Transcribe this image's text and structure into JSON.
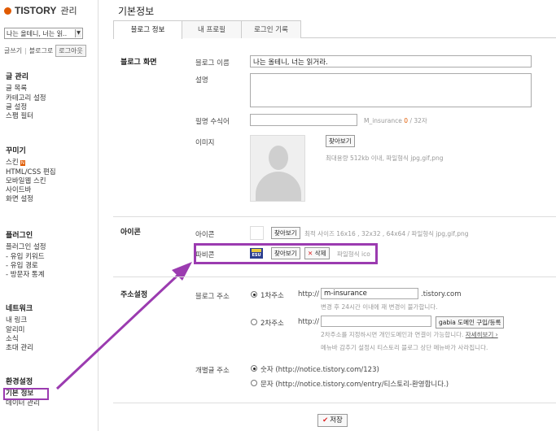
{
  "app": {
    "logo": "TISTORY",
    "logo_sub": "관리",
    "blog_selector": "나는 올테니, 너는 읽.."
  },
  "quick": {
    "write": "글쓰기",
    "blog": "블로그로",
    "logout": "로그아웃"
  },
  "menu": [
    {
      "title": "글 관리",
      "items": [
        "글 목록",
        "카테고리 설정",
        "글 설정",
        "스팸 필터"
      ]
    },
    {
      "title": "꾸미기",
      "items": [
        "스킨",
        "HTML/CSS 편집",
        "모바일웹 스킨",
        "사이드바",
        "화면 설정"
      ],
      "new_badge": "N"
    },
    {
      "title": "플러그인",
      "items": [
        "플러그인 설정",
        "- 유입 키워드",
        "- 유입 경로",
        "- 방문자 통계"
      ]
    },
    {
      "title": "네트워크",
      "items": [
        "내 링크",
        "알리미",
        "소식",
        "초대 관리"
      ]
    },
    {
      "title": "환경설정",
      "items": [
        "기본 정보",
        "데이터 관리"
      ],
      "active_item": "기본 정보"
    }
  ],
  "page": {
    "title": "기본정보",
    "tabs": [
      "블로그 정보",
      "내 프로필",
      "로그인 기록"
    ],
    "active_tab": "블로그 정보",
    "blog_screen": {
      "header": "블로그 화면",
      "name_label": "블로그 이름",
      "name_value": "나는 올테니, 너는 읽거라.",
      "desc_label": "설명",
      "desc_value": "",
      "nick_label": "필명 수식어",
      "nick_hint": "M_insurance",
      "nick_count": "0",
      "nick_max": "/ 32자",
      "image_label": "이미지",
      "find_button": "찾아보기",
      "image_hint": "최대용량 512kb 이내, 파일형식 jpg,gif,png"
    },
    "icon": {
      "header": "아이콘",
      "icon_label": "아이콘",
      "find_button": "찾아보기",
      "icon_hint": "최적 사이즈 16x16 , 32x32 , 64x64 / 파일형식 jpg,gif,png",
      "favicon_label": "파비콘",
      "favicon_find": "찾아보기",
      "favicon_delete": "삭제",
      "favicon_hint": "파일형식 ico",
      "favicon_text": "ESU"
    },
    "address": {
      "header": "주소설정",
      "blog_addr_label": "블로그 주소",
      "primary_label": "1차주소",
      "primary_prefix": "http://",
      "primary_value": "m-insurance",
      "primary_suffix": ".tistory.com",
      "primary_note": "변경 후 24시간 이내에 재 변경이 불가합니다.",
      "secondary_label": "2차주소",
      "secondary_prefix": "http://",
      "secondary_value": "",
      "gabia_button": "gabia 도메인 구입/등록",
      "secondary_note1": "2차주소를 지정하시면 개인도메인과 연결이 가능합니다.",
      "secondary_more": "자세히보기 ›",
      "secondary_note2": "메뉴바 감추기 설정시 티스토리 블로그 상단 메뉴바가 사라집니다.",
      "post_addr_label": "개별글 주소",
      "opt_number": "숫자 (http://notice.tistory.com/123)",
      "opt_text": "문자 (http://notice.tistory.com/entry/티스토리-환영합니다.)"
    },
    "save_button": "저장"
  },
  "colors": {
    "accent": "#e05a00",
    "highlight": "#9b3bb0"
  }
}
